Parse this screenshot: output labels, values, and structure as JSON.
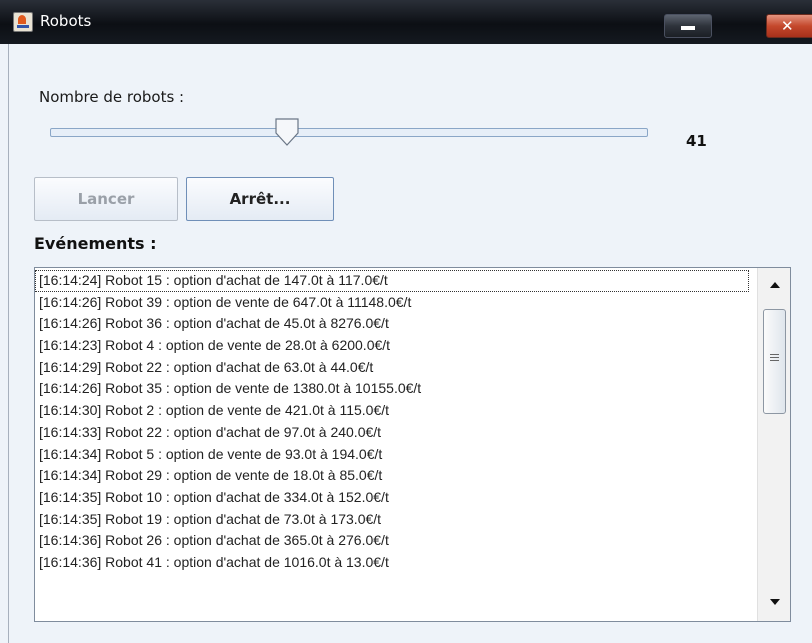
{
  "window": {
    "title": "Robots"
  },
  "controls": {
    "robot_count_label": "Nombre de robots :",
    "slider_value": "41",
    "launch_button": "Lancer",
    "stop_button": "Arrêt...",
    "events_label": "Evénements :"
  },
  "events": [
    "[16:14:24] Robot 15 : option d'achat de 147.0t à 117.0€/t",
    "[16:14:26] Robot 39 : option de vente de 647.0t à 11148.0€/t",
    "[16:14:26] Robot 36 : option d'achat de 45.0t à 8276.0€/t",
    "[16:14:23] Robot 4 : option de vente de 28.0t à 6200.0€/t",
    "[16:14:29] Robot 22 : option d'achat de 63.0t à 44.0€/t",
    "[16:14:26] Robot 35 : option de vente de 1380.0t à 10155.0€/t",
    "[16:14:30] Robot 2 : option de vente de 421.0t à 115.0€/t",
    "[16:14:33] Robot 22 : option d'achat de 97.0t à 240.0€/t",
    "[16:14:34] Robot 5 : option de vente de 93.0t à 194.0€/t",
    "[16:14:34] Robot 29 : option de vente de 18.0t à 85.0€/t",
    "[16:14:35] Robot 10 : option d'achat de 334.0t à 152.0€/t",
    "[16:14:35] Robot 19 : option d'achat de 73.0t à 173.0€/t",
    "[16:14:36] Robot 26 : option d'achat de 365.0t à 276.0€/t",
    "[16:14:36] Robot 41 : option d'achat de 1016.0t à 13.0€/t"
  ]
}
